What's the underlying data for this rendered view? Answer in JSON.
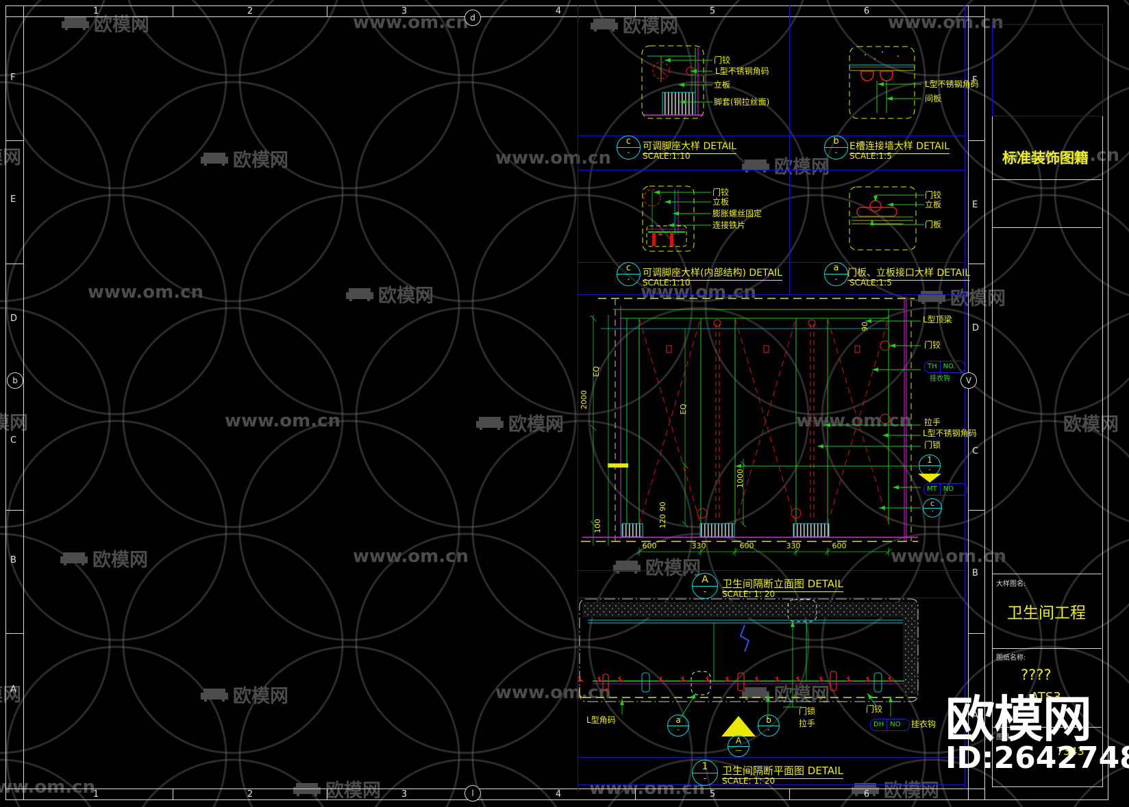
{
  "watermark": {
    "brand": "欧模网",
    "url": "www.om.cn",
    "id_label": "ID:2642748"
  },
  "sheet": {
    "cols": [
      "1",
      "2",
      "3",
      "4",
      "5",
      "6"
    ],
    "rows_left": [
      "F",
      "E",
      "D",
      "C",
      "B",
      "A"
    ],
    "rows_right": [
      "F",
      "E",
      "D",
      "C",
      "B",
      "A"
    ],
    "top_bubble": "d",
    "bottom_bubble": "l",
    "left_bubble": "b",
    "right_bubble": "V"
  },
  "details": [
    {
      "marker": "c",
      "sub": "-",
      "title": "可调脚座大样 DETAIL",
      "scale": "SCALE:1:10",
      "labels": [
        "门铰",
        "L型不锈钢角码",
        "立板",
        "脚套(钢拉丝面)"
      ]
    },
    {
      "marker": "b",
      "sub": "-",
      "title": "E槽连接墙大样 DETAIL",
      "scale": "SCALE:1:5",
      "labels": [
        "L型不锈钢角码",
        "间板"
      ]
    },
    {
      "marker": "c",
      "sub": "-",
      "title": "可调脚座大样(内部结构) DETAIL",
      "scale": "SCALE:1:10",
      "labels": [
        "门铰",
        "立板",
        "膨胀螺丝固定",
        "连接铁片"
      ]
    },
    {
      "marker": "a",
      "sub": "-",
      "title": "门板、立板接口大样 DETAIL",
      "scale": "SCALE:1:5",
      "labels": [
        "门铰",
        "立板",
        "门板"
      ]
    }
  ],
  "elevation": {
    "marker": "A",
    "sub": "-",
    "title": "卫生间隔断立面图  DETAIL",
    "scale": "SCALE: 1: 20",
    "right_labels": {
      "top_beam": "L型顶梁",
      "hinge": "门铰",
      "hook": "挂衣钩",
      "handle": "拉手",
      "bracket": "L型不锈钢角码",
      "lock": "门锁"
    },
    "th_box": {
      "l": "TH",
      "r": "NO."
    },
    "mt_box": {
      "l": "MT",
      "r": "NO"
    },
    "sec_marker": "1",
    "sec_sub": "-",
    "c_marker": "c",
    "c_sub": "-",
    "dims": {
      "top90": "90",
      "eq1": "EQ",
      "eq2": "EQ",
      "height": "2000",
      "mid1000": "1000",
      "s120": "120",
      "s90": "90",
      "base100": "100",
      "bottom": [
        "600",
        "330",
        "600",
        "330",
        "600"
      ]
    }
  },
  "plan": {
    "marker": "1",
    "sub": "-",
    "title": "卫生间隔断平面图  DETAIL",
    "scale": "SCALE: 1: 20",
    "labels": {
      "corner": "L型角码",
      "lock": "门锁",
      "handle": "拉手",
      "hinge": "门铰",
      "hook": "挂衣钩"
    },
    "dh_box": {
      "l": "DH",
      "r": "NO"
    },
    "callout_a": "a",
    "callout_a_sub": "-",
    "callout_b": "b",
    "callout_b_sub": "-",
    "section": "A",
    "section_sub": "—"
  },
  "titleblock": {
    "header": "标准装饰图籍",
    "name_label": "大样图名:",
    "project": "卫生间工程",
    "drawing_label": "图纸名称:",
    "drawing_title": "????",
    "code": "ATS3",
    "no_label": "图号:",
    "sheet_no": "7343"
  }
}
